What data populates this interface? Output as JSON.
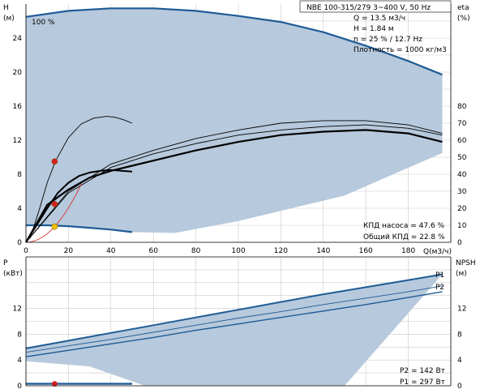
{
  "chart_data": [
    {
      "type": "line",
      "title": "NBE 100-315/279   3~400 V, 50 Hz",
      "xlabel": "Q(м3/ч)",
      "ylabel_left": [
        "H",
        "(м)"
      ],
      "ylabel_right": [
        "eta",
        "(%)"
      ],
      "xlim": [
        0,
        200
      ],
      "ylim_left": [
        0,
        28
      ],
      "ylim_right": [
        0,
        140
      ],
      "x_ticks": [
        0,
        20,
        40,
        60,
        80,
        100,
        120,
        140,
        160,
        180
      ],
      "y_ticks_left": [
        0,
        4,
        8,
        12,
        16,
        20,
        24
      ],
      "y_ticks_right": [
        0,
        10,
        20,
        30,
        40,
        50,
        60,
        70,
        80
      ],
      "grid": true,
      "info": [
        "Q = 13.5 м3/ч",
        "H = 1.84 м",
        "n = 25 % / 12.7 Hz",
        "Плотность = 1000 кг/м3"
      ],
      "speed_label": "100 %",
      "efficiency_labels": [
        "КПД насоса = 47.6 %",
        "Общий КПД = 22.8 %"
      ],
      "series": [
        {
          "role": "envelope-max",
          "axis": "left",
          "color": "#1f5b96",
          "x": [
            0,
            20,
            40,
            60,
            80,
            100,
            120,
            140,
            160,
            180,
            196
          ],
          "y": [
            26.5,
            27.2,
            27.5,
            27.5,
            27.2,
            26.6,
            25.9,
            24.7,
            23.1,
            21.3,
            19.7
          ]
        },
        {
          "role": "envelope-min",
          "axis": "left",
          "color": "#1f5b96",
          "x": [
            0,
            10,
            20,
            30,
            40,
            50
          ],
          "y": [
            2.0,
            2.0,
            1.9,
            1.7,
            1.5,
            1.2
          ]
        },
        {
          "role": "head-curve",
          "axis": "left",
          "color": "#000000",
          "x": [
            2,
            6,
            10,
            14,
            20,
            26,
            32,
            38,
            42,
            46,
            50
          ],
          "y": [
            0.5,
            3.6,
            7.0,
            9.6,
            12.3,
            13.9,
            14.6,
            14.8,
            14.7,
            14.4,
            14.0
          ]
        },
        {
          "role": "eta-pump",
          "axis": "right",
          "color": "#000000",
          "x": [
            0,
            20,
            40,
            60,
            80,
            100,
            120,
            140,
            160,
            180,
            196
          ],
          "y": [
            0,
            30,
            46,
            54,
            61,
            66,
            70,
            71.5,
            71.5,
            69,
            64
          ]
        },
        {
          "role": "eta-system",
          "axis": "right",
          "color": "#000000",
          "x": [
            0,
            20,
            40,
            60,
            80,
            100,
            120,
            140,
            160,
            180,
            196
          ],
          "y": [
            0,
            29,
            44,
            52,
            58,
            63,
            66,
            68,
            69,
            67,
            63
          ]
        },
        {
          "role": "eta-bold",
          "axis": "right",
          "color": "#000000",
          "x": [
            0,
            10,
            20,
            30,
            40,
            50,
            60,
            80,
            100,
            120,
            140,
            160,
            180,
            196
          ],
          "y": [
            0,
            22,
            31,
            38,
            42,
            45,
            48,
            54,
            59,
            63,
            65,
            66,
            64,
            59
          ]
        },
        {
          "role": "eta-bold-small",
          "axis": "right",
          "color": "#000000",
          "x": [
            0,
            5,
            10,
            15,
            20,
            25,
            30,
            35,
            40,
            45,
            50
          ],
          "y": [
            0,
            10,
            20,
            29,
            35,
            39,
            41,
            42,
            42.5,
            42,
            41.5
          ]
        }
      ],
      "points": [
        {
          "axis": "left",
          "x": 13.5,
          "y": 9.5,
          "color": "#d42020"
        },
        {
          "axis": "left",
          "x": 13.5,
          "y": 4.5,
          "color": "#d42020"
        },
        {
          "axis": "left",
          "x": 13.5,
          "y": 1.84,
          "color": "#f2c100"
        }
      ]
    },
    {
      "type": "line",
      "ylabel_left": [
        "P",
        "(кВт)"
      ],
      "ylabel_right": [
        "NPSH",
        "(м)"
      ],
      "xlim": [
        0,
        200
      ],
      "ylim_left": [
        0,
        20
      ],
      "ylim_right": [
        0,
        20
      ],
      "y_ticks_left": [
        0,
        4,
        8,
        12
      ],
      "y_ticks_right": [
        0,
        4,
        8,
        12
      ],
      "grid": true,
      "power_labels": [
        "P2 = 142 Вт",
        "P1 = 297 Вт"
      ],
      "series": [
        {
          "name": "P1",
          "role": "power-band-top",
          "color": "#1f5b96",
          "x": [
            0,
            20,
            40,
            60,
            80,
            100,
            120,
            140,
            160,
            180,
            196
          ],
          "y": [
            5.8,
            7.0,
            8.2,
            9.4,
            10.6,
            11.8,
            13.0,
            14.2,
            15.3,
            16.4,
            17.3
          ]
        },
        {
          "name": "P2",
          "role": "power-band-mid",
          "color": "#1f5b96",
          "x": [
            0,
            20,
            40,
            60,
            80,
            100,
            120,
            140,
            160,
            180,
            196
          ],
          "y": [
            5.2,
            6.2,
            7.2,
            8.3,
            9.4,
            10.5,
            11.5,
            12.6,
            13.6,
            14.6,
            15.5
          ]
        },
        {
          "role": "power-band-bottom",
          "color": "#1f5b96",
          "x": [
            0,
            20,
            40,
            60,
            80,
            100,
            120,
            140,
            160,
            180,
            196
          ],
          "y": [
            4.5,
            5.5,
            6.5,
            7.5,
            8.6,
            9.6,
            10.6,
            11.6,
            12.6,
            13.7,
            14.6
          ]
        },
        {
          "role": "low-power",
          "color": "#1f5b96",
          "x": [
            0,
            50
          ],
          "y": [
            0.3,
            0.3
          ]
        }
      ],
      "points": [
        {
          "x": 13.5,
          "y": 0.3,
          "color": "#d42020"
        }
      ]
    }
  ]
}
